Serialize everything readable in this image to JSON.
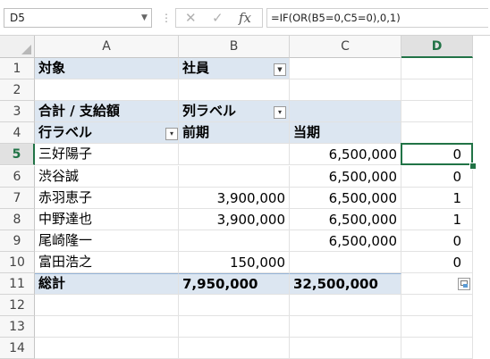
{
  "formula_bar": {
    "name_box": "D5",
    "dots": "⋮",
    "cancel_glyph": "✕",
    "enter_glyph": "✓",
    "fx_glyph": "fx",
    "formula": "=IF(OR(B5=0,C5=0),0,1)"
  },
  "columns": [
    "A",
    "B",
    "C",
    "D"
  ],
  "rows": [
    "1",
    "2",
    "3",
    "4",
    "5",
    "6",
    "7",
    "8",
    "9",
    "10",
    "11",
    "12",
    "13",
    "14"
  ],
  "selected_cell": "D5",
  "cells": {
    "A1": "対象",
    "B1": "社員",
    "A3": "合計 / 支給額",
    "B3": "列ラベル",
    "A4": "行ラベル",
    "B4": "前期",
    "C4": "当期",
    "A5": "三好陽子",
    "C5": "6,500,000",
    "D5": "0",
    "A6": "渋谷誠",
    "C6": "6,500,000",
    "D6": "0",
    "A7": "赤羽恵子",
    "B7": "3,900,000",
    "C7": "6,500,000",
    "D7": "1",
    "A8": "中野達也",
    "B8": "3,900,000",
    "C8": "6,500,000",
    "D8": "1",
    "A9": "尾崎隆一",
    "C9": "6,500,000",
    "D9": "0",
    "A10": "富田浩之",
    "B10": "150,000",
    "D10": "0",
    "A11": "総計",
    "B11": "7,950,000",
    "C11": "32,500,000"
  },
  "filter_icons": {
    "report_filter": "▼",
    "dropdown": "▾"
  },
  "colors": {
    "pivot_header_bg": "#dce6f1",
    "selection_green": "#217346",
    "grid_line": "#e2e2e2"
  }
}
